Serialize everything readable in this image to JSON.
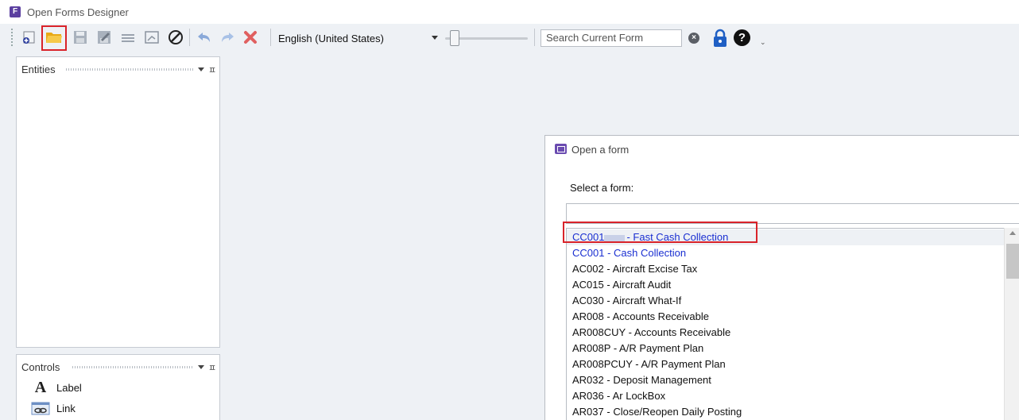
{
  "window": {
    "title": "Open Forms Designer",
    "icon": "F"
  },
  "toolbar": {
    "buttons": [
      {
        "name": "new-form-icon"
      },
      {
        "name": "open-folder-icon"
      },
      {
        "name": "save-icon"
      },
      {
        "name": "save-as-icon"
      },
      {
        "name": "print-icon"
      },
      {
        "name": "form-properties-icon"
      },
      {
        "name": "cancel-icon"
      },
      {
        "name": "undo-icon"
      },
      {
        "name": "redo-icon"
      },
      {
        "name": "delete-icon"
      }
    ],
    "language": "English (United States)",
    "zoom_level": 0.06,
    "search_placeholder": "Search Current Form",
    "search_clear_glyph": "×",
    "help_glyph": "?",
    "overflow_glyph": "⌄"
  },
  "panels": {
    "entities": {
      "title": "Entities",
      "pin_glyph": "ㅍ"
    },
    "controls": {
      "title": "Controls",
      "pin_glyph": "ㅍ",
      "items": [
        {
          "label": "Label",
          "icon": "label-icon",
          "glyph": "A"
        },
        {
          "label": "Link",
          "icon": "link-icon"
        }
      ]
    }
  },
  "dialog": {
    "title": "Open a form",
    "prompt": "Select a form:",
    "filter_value": "",
    "forms": [
      {
        "code": "CC001",
        "masked": true,
        "name": "- Fast Cash Collection",
        "selected": true,
        "color": "#1a2fd1"
      },
      {
        "code": "CC001",
        "masked": false,
        "name": "- Cash Collection",
        "selected": false,
        "color": "#1a2fd1"
      },
      {
        "code": "AC002",
        "masked": false,
        "name": "- Aircraft Excise Tax",
        "selected": false
      },
      {
        "code": "AC015",
        "masked": false,
        "name": "- Aircraft Audit",
        "selected": false
      },
      {
        "code": "AC030",
        "masked": false,
        "name": "- Aircraft What-If",
        "selected": false
      },
      {
        "code": "AR008",
        "masked": false,
        "name": "- Accounts Receivable",
        "selected": false
      },
      {
        "code": "AR008CUY",
        "masked": false,
        "name": "- Accounts Receivable",
        "selected": false
      },
      {
        "code": "AR008P",
        "masked": false,
        "name": "- A/R Payment Plan",
        "selected": false
      },
      {
        "code": "AR008PCUY",
        "masked": false,
        "name": "- A/R Payment Plan",
        "selected": false
      },
      {
        "code": "AR032",
        "masked": false,
        "name": "- Deposit Management",
        "selected": false
      },
      {
        "code": "AR036",
        "masked": false,
        "name": "- Ar LockBox",
        "selected": false
      },
      {
        "code": "AR037",
        "masked": false,
        "name": "- Close/Reopen Daily Posting",
        "selected": false
      }
    ]
  },
  "colors": {
    "highlight": "#d9232a",
    "link_blue": "#1a2fd1",
    "accent_purple": "#5b3fa0"
  }
}
